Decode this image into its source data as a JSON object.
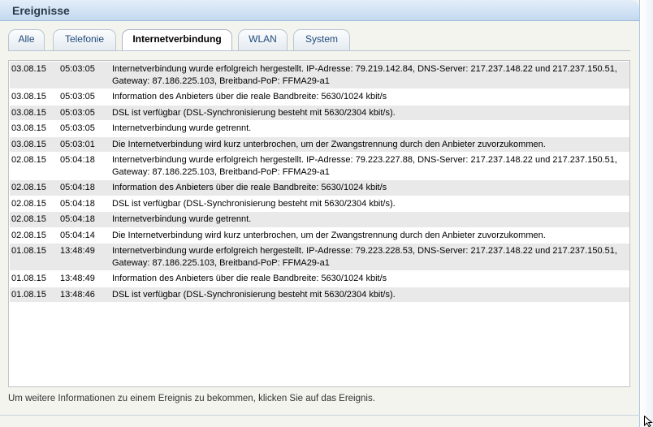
{
  "panel": {
    "title": "Ereignisse"
  },
  "tabs": [
    {
      "label": "Alle",
      "active": false
    },
    {
      "label": "Telefonie",
      "active": false
    },
    {
      "label": "Internetverbindung",
      "active": true
    },
    {
      "label": "WLAN",
      "active": false
    },
    {
      "label": "System",
      "active": false
    }
  ],
  "events": [
    {
      "date": "03.08.15",
      "time": "05:03:05",
      "message": "Internetverbindung wurde erfolgreich hergestellt. IP-Adresse: 79.219.142.84, DNS-Server: 217.237.148.22 und 217.237.150.51, Gateway: 87.186.225.103, Breitband-PoP: FFMA29-a1"
    },
    {
      "date": "03.08.15",
      "time": "05:03:05",
      "message": "Information des Anbieters über die reale Bandbreite: 5630/1024 kbit/s"
    },
    {
      "date": "03.08.15",
      "time": "05:03:05",
      "message": "DSL ist verfügbar (DSL-Synchronisierung besteht mit 5630/2304 kbit/s)."
    },
    {
      "date": "03.08.15",
      "time": "05:03:05",
      "message": "Internetverbindung wurde getrennt."
    },
    {
      "date": "03.08.15",
      "time": "05:03:01",
      "message": "Die Internetverbindung wird kurz unterbrochen, um der Zwangstrennung durch den Anbieter zuvorzukommen."
    },
    {
      "date": "02.08.15",
      "time": "05:04:18",
      "message": "Internetverbindung wurde erfolgreich hergestellt. IP-Adresse: 79.223.227.88, DNS-Server: 217.237.148.22 und 217.237.150.51, Gateway: 87.186.225.103, Breitband-PoP: FFMA29-a1"
    },
    {
      "date": "02.08.15",
      "time": "05:04:18",
      "message": "Information des Anbieters über die reale Bandbreite: 5630/1024 kbit/s"
    },
    {
      "date": "02.08.15",
      "time": "05:04:18",
      "message": "DSL ist verfügbar (DSL-Synchronisierung besteht mit 5630/2304 kbit/s)."
    },
    {
      "date": "02.08.15",
      "time": "05:04:18",
      "message": "Internetverbindung wurde getrennt."
    },
    {
      "date": "02.08.15",
      "time": "05:04:14",
      "message": "Die Internetverbindung wird kurz unterbrochen, um der Zwangstrennung durch den Anbieter zuvorzukommen."
    },
    {
      "date": "01.08.15",
      "time": "13:48:49",
      "message": "Internetverbindung wurde erfolgreich hergestellt. IP-Adresse: 79.223.228.53, DNS-Server: 217.237.148.22 und 217.237.150.51, Gateway: 87.186.225.103, Breitband-PoP: FFMA29-a1"
    },
    {
      "date": "01.08.15",
      "time": "13:48:49",
      "message": "Information des Anbieters über die reale Bandbreite: 5630/1024 kbit/s"
    },
    {
      "date": "01.08.15",
      "time": "13:48:46",
      "message": "DSL ist verfügbar (DSL-Synchronisierung besteht mit 5630/2304 kbit/s)."
    }
  ],
  "hint": "Um weitere Informationen zu einem Ereignis zu bekommen, klicken Sie auf das Ereignis.",
  "icons": {
    "cursor": "mouse-pointer-icon"
  },
  "colors": {
    "header_bg": "#c3d9f0",
    "tab_text": "#1f4a7a",
    "row_alt": "#e9e9e9"
  }
}
